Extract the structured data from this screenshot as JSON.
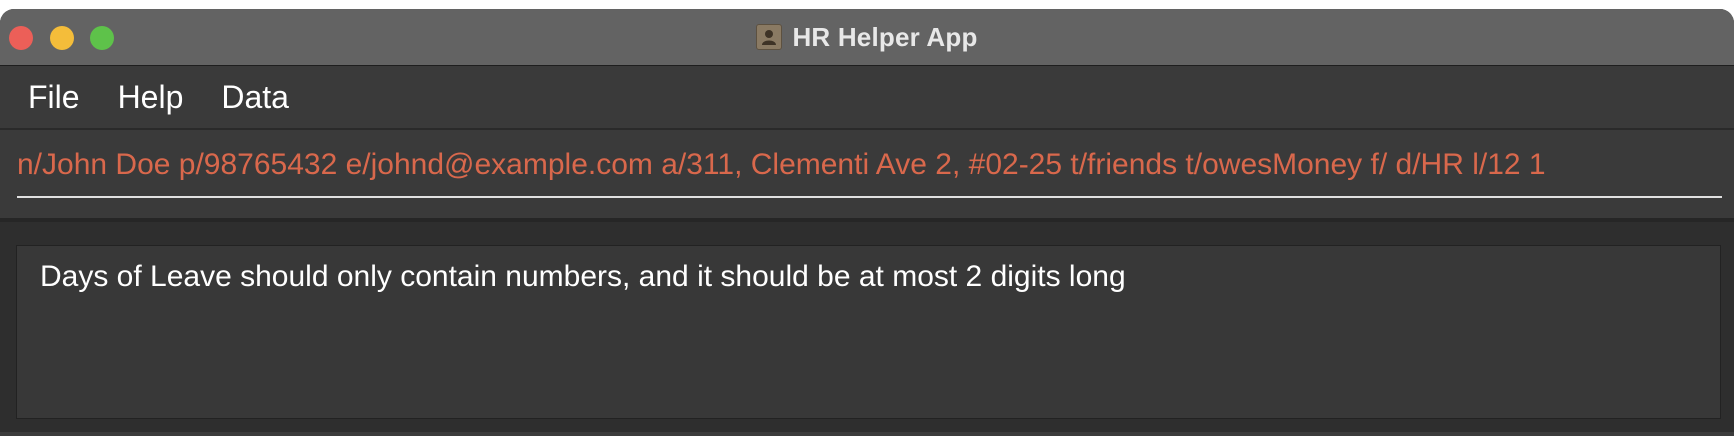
{
  "window": {
    "title": "HR Helper App",
    "app_icon": "contact-card-icon"
  },
  "traffic_lights": {
    "close_color": "#ec5f58",
    "minimize_color": "#f4bd3a",
    "maximize_color": "#5ec24a"
  },
  "menu": {
    "items": [
      {
        "label": "File"
      },
      {
        "label": "Help"
      },
      {
        "label": "Data"
      }
    ]
  },
  "command": {
    "value": "n/John Doe p/98765432 e/johnd@example.com a/311, Clementi Ave 2, #02-25 t/friends t/owesMoney f/ d/HR l/12 1",
    "text_color": "#d9684c"
  },
  "result": {
    "message": "Days of Leave should only contain numbers, and it should be at most 2 digits long"
  }
}
